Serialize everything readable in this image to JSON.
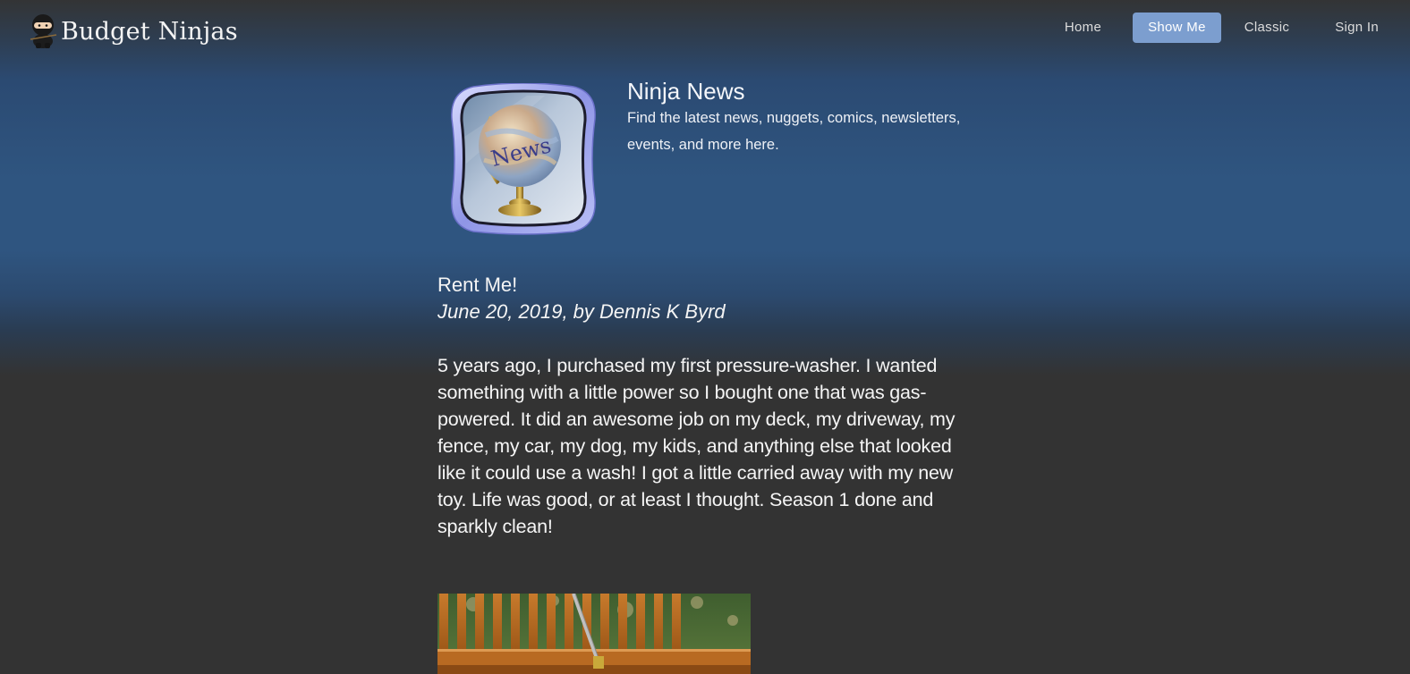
{
  "header": {
    "brand": "Budget Ninjas",
    "brand_icon": "ninja-icon",
    "nav": [
      {
        "label": "Home"
      },
      {
        "label": "Show Me"
      },
      {
        "label": "Classic"
      },
      {
        "label": "Sign In"
      }
    ],
    "active_nav": "Show Me",
    "active_color": "#7c9ecf"
  },
  "news": {
    "icon": "globe-icon",
    "icon_label": "News",
    "title": "Ninja News",
    "description": "Find the latest news, nuggets, comics, newsletters, events, and more here."
  },
  "article": {
    "title": "Rent Me!",
    "byline": "June 20, 2019, by Dennis K Byrd",
    "body": "5 years ago, I purchased my first pressure-washer. I wanted something with a little power so I bought one that was gas-powered. It did an awesome job on my deck, my driveway, my fence, my car, my dog, my kids, and anything else that looked like it could use a wash! I got a little carried away with my new toy. Life was good, or at least I thought. Season 1 done and sparkly clean!"
  }
}
